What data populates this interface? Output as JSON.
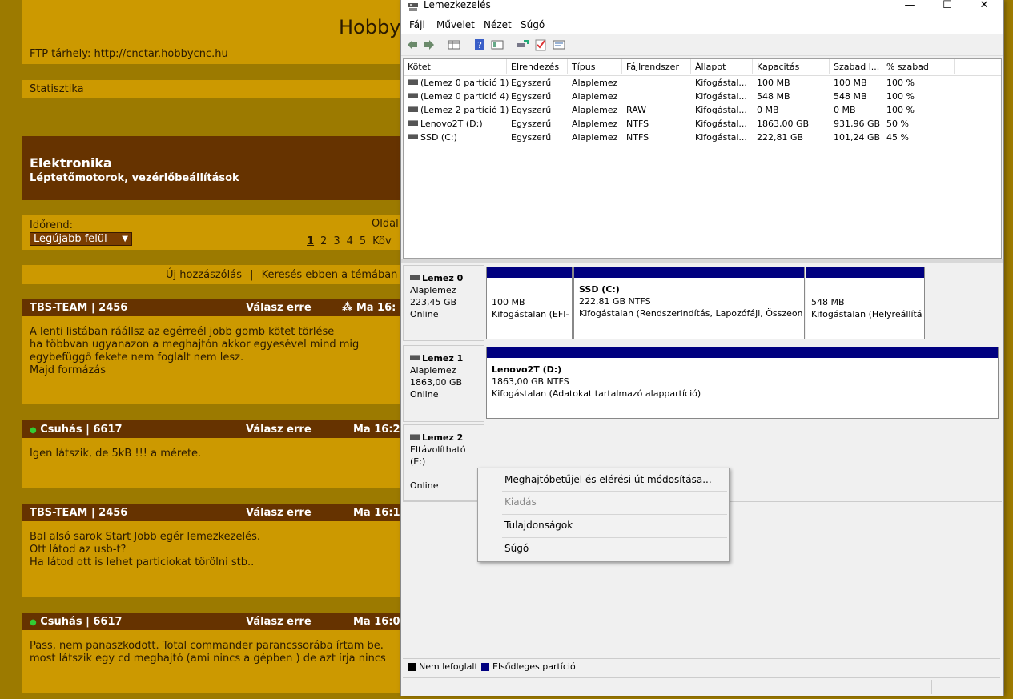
{
  "forum": {
    "site_title": "Hobby",
    "ftp_line": "FTP tárhely: http://cnctar.hobbycnc.hu",
    "stat_link": "Statisztika",
    "section_title": "Elektronika",
    "section_subtitle": "Léptetőmotorok, vezérlőbeállítások",
    "sort_label": "Időrend:",
    "sort_value": "Legújabb felül",
    "oldal_label": "Oldal",
    "pages": [
      "1",
      "2",
      "3",
      "4",
      "5",
      "Köv"
    ],
    "new_post": "Új hozzászólás",
    "separator": "|",
    "search": "Keresés ebben a témában",
    "posts": [
      {
        "author": "TBS-TEAM | 2456",
        "reply": "Válasz erre",
        "time": "⁂ Ma 16:",
        "online": false,
        "lines": [
          "A lenti listában ráállsz az egérreél jobb gomb kötet törlése",
          "ha többvan ugyanazon a meghajtón akkor egyesével mind mig",
          "egybefüggő fekete nem foglalt nem lesz.",
          "Majd formázás"
        ]
      },
      {
        "author": "Csuhás | 6617",
        "reply": "Válasz erre",
        "time": "Ma 16:2",
        "online": true,
        "lines": [
          "Igen látszik, de 5kB !!! a mérete."
        ]
      },
      {
        "author": "TBS-TEAM | 2456",
        "reply": "Válasz erre",
        "time": "Ma 16:1",
        "online": false,
        "lines": [
          "Bal alsó sarok Start Jobb egér lemezkezelés.",
          "Ott látod az usb-t?",
          "Ha látod ott is lehet particiokat törölni stb.."
        ]
      },
      {
        "author": "Csuhás | 6617",
        "reply": "Válasz erre",
        "time": "Ma 16:0",
        "online": true,
        "lines": [
          "Pass, nem panaszkodott. Total commander parancssorába írtam be.",
          "most látszik egy cd meghajtó (ami nincs a gépben ) de azt írja nincs"
        ]
      }
    ]
  },
  "window": {
    "title": "Lemezkezelés",
    "minimize": "—",
    "maximize": "☐",
    "close": "✕",
    "menu": [
      "Fájl",
      "Művelet",
      "Nézet",
      "Súgó"
    ],
    "toolbar_icons": [
      "back-icon",
      "forward-icon",
      "grid-icon",
      "help-icon",
      "properties-icon",
      "connect-icon",
      "check-icon",
      "settings-icon"
    ],
    "columns": [
      "Kötet",
      "Elrendezés",
      "Típus",
      "Fájlrendszer",
      "Állapot",
      "Kapacitás",
      "Szabad l...",
      "% szabad"
    ],
    "volumes": [
      [
        "(Lemez 0 partíció 1)",
        "Egyszerű",
        "Alaplemez",
        "",
        "Kifogástal...",
        "100 MB",
        "100 MB",
        "100 %"
      ],
      [
        "(Lemez 0 partíció 4)",
        "Egyszerű",
        "Alaplemez",
        "",
        "Kifogástal...",
        "548 MB",
        "548 MB",
        "100 %"
      ],
      [
        "(Lemez 2 partíció 1)",
        "Egyszerű",
        "Alaplemez",
        "RAW",
        "Kifogástal...",
        "0 MB",
        "0 MB",
        "100 %"
      ],
      [
        "Lenovo2T (D:)",
        "Egyszerű",
        "Alaplemez",
        "NTFS",
        "Kifogástal...",
        "1863,00 GB",
        "931,96 GB",
        "50 %"
      ],
      [
        "SSD (C:)",
        "Egyszerű",
        "Alaplemez",
        "NTFS",
        "Kifogástal...",
        "222,81 GB",
        "101,24 GB",
        "45 %"
      ]
    ],
    "disks": [
      {
        "name": "Lemez 0",
        "type": "Alaplemez",
        "size": "223,45 GB",
        "status": "Online",
        "partitions": [
          {
            "name": "",
            "size": "100 MB",
            "status": "Kifogástalan (EFI-"
          },
          {
            "name": "SSD  (C:)",
            "size": "222,81 GB NTFS",
            "status": "Kifogástalan (Rendszerindítás, Lapozófájl, Összeomlá"
          },
          {
            "name": "",
            "size": "548 MB",
            "status": "Kifogástalan (Helyreállítá:"
          }
        ]
      },
      {
        "name": "Lemez 1",
        "type": "Alaplemez",
        "size": "1863,00 GB",
        "status": "Online",
        "partitions": [
          {
            "name": "Lenovo2T  (D:)",
            "size": "1863,00 GB NTFS",
            "status": "Kifogástalan (Adatokat tartalmazó alappartíció)"
          }
        ]
      },
      {
        "name": "Lemez 2",
        "type": "Eltávolítható (E:)",
        "size": "",
        "status": "Online",
        "partitions": []
      }
    ],
    "legend": [
      {
        "label": "Nem lefoglalt",
        "color": "#000000"
      },
      {
        "label": "Elsődleges partíció",
        "color": "#000080"
      }
    ]
  },
  "context_menu": {
    "items": [
      {
        "label": "Meghajtóbetűjel és elérési út módosítása...",
        "disabled": false
      },
      {
        "label": "Kiadás",
        "disabled": true
      },
      {
        "label": "Tulajdonságok",
        "disabled": false
      },
      {
        "label": "Súgó",
        "disabled": false
      }
    ]
  }
}
